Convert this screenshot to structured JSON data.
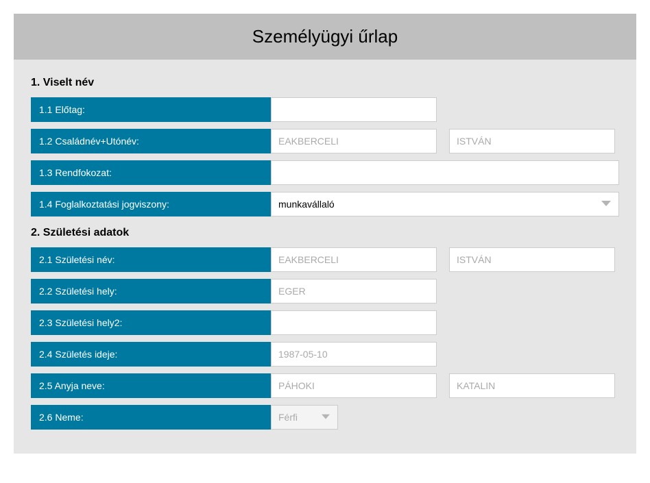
{
  "title": "Személyügyi űrlap",
  "section1": {
    "heading": "1. Viselt név",
    "r1_label": "1.1 Előtag:",
    "r2_label": "1.2 Családnév+Utónév:",
    "r2_family_ph": "EAKBERCELI",
    "r2_given_ph": "ISTVÁN",
    "r3_label": "1.3 Rendfokozat:",
    "r4_label": "1.4 Foglalkoztatási jogviszony:",
    "r4_value": "munkavállaló"
  },
  "section2": {
    "heading": "2. Születési adatok",
    "r1_label": "2.1 Születési név:",
    "r1_family_ph": "EAKBERCELI",
    "r1_given_ph": "ISTVÁN",
    "r2_label": "2.2 Születési hely:",
    "r2_ph": "EGER",
    "r3_label": "2.3 Születési hely2:",
    "r4_label": "2.4 Születés ideje:",
    "r4_ph": "1987-05-10",
    "r5_label": "2.5 Anyja neve:",
    "r5_family_ph": "PÁHOKI",
    "r5_given_ph": "KATALIN",
    "r6_label": "2.6 Neme:",
    "r6_value": "Férfi"
  }
}
